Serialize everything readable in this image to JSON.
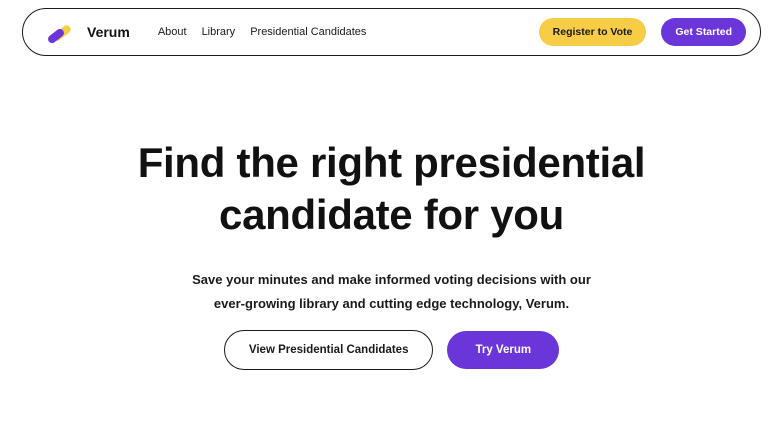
{
  "nav": {
    "brand": "Verum",
    "logo_icon": "verum-logo-icon",
    "links": [
      {
        "label": "About"
      },
      {
        "label": "Library"
      },
      {
        "label": "Presidential Candidates"
      }
    ],
    "register_label": "Register to Vote",
    "get_started_label": "Get Started"
  },
  "hero": {
    "title_line1": "Find the right presidential",
    "title_line2": "candidate for you",
    "subtitle_line1": "Save your minutes and make informed voting decisions with our",
    "subtitle_line2": "ever-growing library and cutting edge technology, Verum.",
    "primary_cta": "View Presidential Candidates",
    "secondary_cta": "Try Verum"
  },
  "colors": {
    "brand_purple": "#6a35d9",
    "accent_yellow": "#f7cd45",
    "text_dark": "#111111",
    "background": "#ffffff"
  }
}
